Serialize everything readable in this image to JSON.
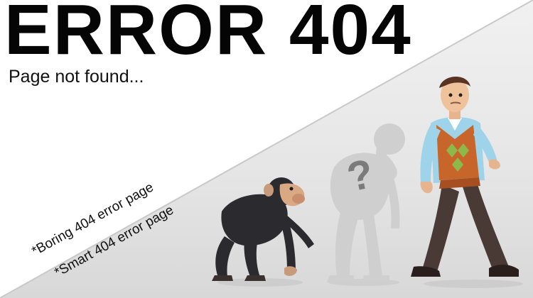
{
  "heading": {
    "title": "ERROR 404",
    "subtitle": "Page not found..."
  },
  "captions": {
    "boring": "*Boring 404 error page",
    "smart": "*Smart 404 error page"
  },
  "illustration": {
    "question_mark": "?",
    "figures": [
      "chimpanzee",
      "ghost-ape-man",
      "man-in-sweater-vest"
    ]
  },
  "colors": {
    "text": "#050505",
    "divider": "#c9c9c9",
    "sweater": "#c8652a",
    "shirt": "#9fd3ea",
    "trousers": "#4a3a36",
    "ape": "#2b2b2f",
    "ghost": "#cfcfcf"
  }
}
